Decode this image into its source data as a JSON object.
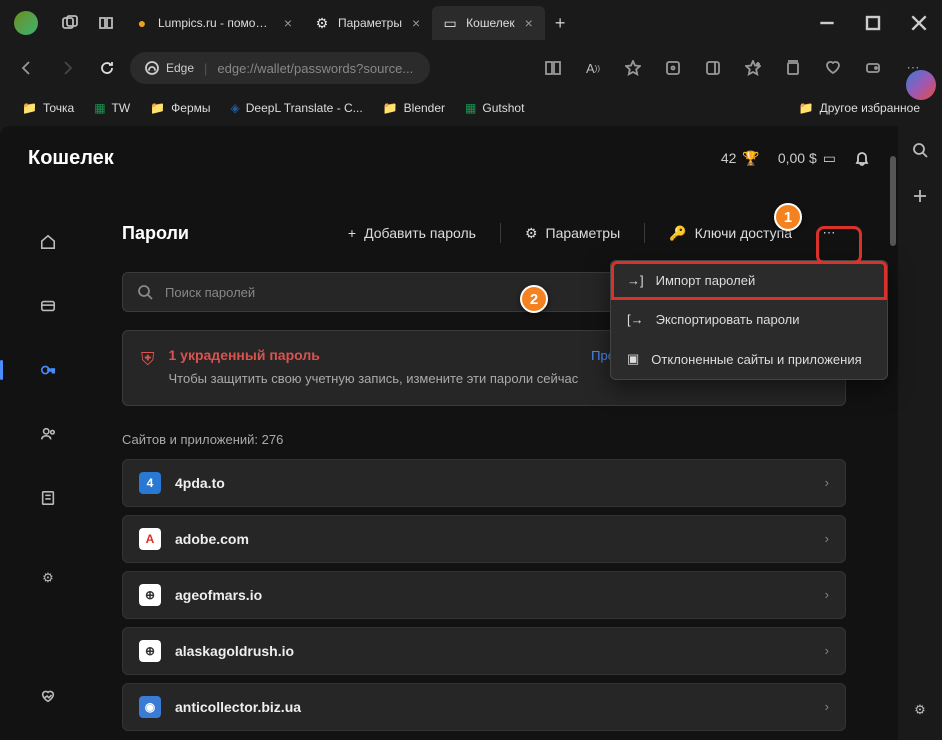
{
  "titlebar": {
    "tabs": [
      {
        "label": "Lumpics.ru - помощь с",
        "favcolor": "#f0a020"
      },
      {
        "label": "Параметры",
        "favcolor": "#888"
      },
      {
        "label": "Кошелек",
        "favcolor": "#999",
        "active": true
      }
    ]
  },
  "toolbar": {
    "identity": "Edge",
    "url": "edge://wallet/passwords?source..."
  },
  "bookmarks": {
    "items": [
      {
        "label": "Точка",
        "type": "folder"
      },
      {
        "label": "TW",
        "type": "sheet"
      },
      {
        "label": "Фермы",
        "type": "folder"
      },
      {
        "label": "DeepL Translate - C...",
        "type": "link"
      },
      {
        "label": "Blender",
        "type": "folder"
      },
      {
        "label": "Gutshot",
        "type": "sheet"
      }
    ],
    "other": "Другое избранное"
  },
  "wallet": {
    "title": "Кошелек",
    "points": "42",
    "balance": "0,00 $"
  },
  "section": {
    "title": "Пароли",
    "add": "Добавить пароль",
    "settings": "Параметры",
    "passkeys": "Ключи доступа",
    "search_placeholder": "Поиск паролей"
  },
  "alert": {
    "title": "1 украденный пароль",
    "text": "Чтобы защитить свою учетную запись, измените эти пароли сейчас",
    "link": "Просмотреть сведения об утечке"
  },
  "count": {
    "label": "Сайтов и приложений: 276"
  },
  "sites": [
    {
      "name": "4pda.to",
      "bg": "#2878d4",
      "fg": "#fff",
      "ch": "4"
    },
    {
      "name": "adobe.com",
      "bg": "#fff",
      "fg": "#d9322a",
      "ch": "A"
    },
    {
      "name": "ageofmars.io",
      "bg": "#fff",
      "fg": "#333",
      "ch": "⊕"
    },
    {
      "name": "alaskagoldrush.io",
      "bg": "#fff",
      "fg": "#333",
      "ch": "⊕"
    },
    {
      "name": "anticollector.biz.ua",
      "bg": "#3a7bd5",
      "fg": "#fff",
      "ch": "◉"
    }
  ],
  "dropdown": {
    "import": "Импорт паролей",
    "export": "Экспортировать пароли",
    "declined": "Отклоненные сайты и приложения"
  },
  "callouts": {
    "c1": "1",
    "c2": "2"
  }
}
